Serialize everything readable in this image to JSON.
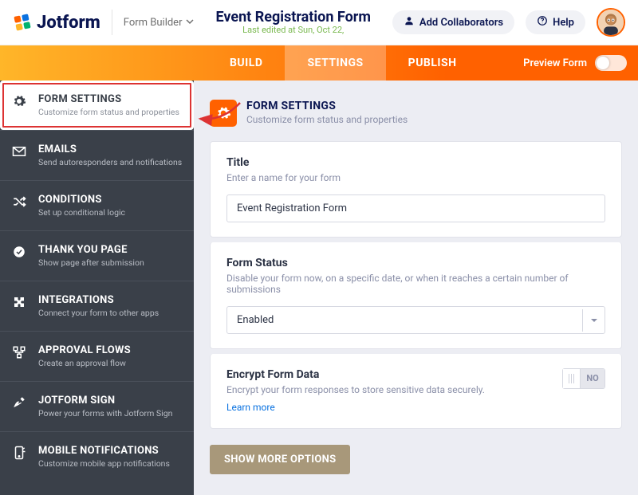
{
  "header": {
    "brand": "Jotform",
    "breadcrumb": "Form Builder",
    "formTitle": "Event Registration Form",
    "lastEdited": "Last edited at Sun, Oct 22,",
    "addCollaborators": "Add Collaborators",
    "help": "Help"
  },
  "tabs": {
    "build": "BUILD",
    "settings": "SETTINGS",
    "publish": "PUBLISH",
    "preview": "Preview Form"
  },
  "sidebar": {
    "items": [
      {
        "title": "FORM SETTINGS",
        "sub": "Customize form status and properties"
      },
      {
        "title": "EMAILS",
        "sub": "Send autoresponders and notifications"
      },
      {
        "title": "CONDITIONS",
        "sub": "Set up conditional logic"
      },
      {
        "title": "THANK YOU PAGE",
        "sub": "Show page after submission"
      },
      {
        "title": "INTEGRATIONS",
        "sub": "Connect your form to other apps"
      },
      {
        "title": "APPROVAL FLOWS",
        "sub": "Create an approval flow"
      },
      {
        "title": "JOTFORM SIGN",
        "sub": "Power your forms with Jotform Sign"
      },
      {
        "title": "MOBILE NOTIFICATIONS",
        "sub": "Customize mobile app notifications"
      }
    ]
  },
  "panel": {
    "head": {
      "title": "FORM SETTINGS",
      "sub": "Customize form status and properties"
    },
    "title": {
      "label": "Title",
      "sub": "Enter a name for your form",
      "value": "Event Registration Form"
    },
    "status": {
      "label": "Form Status",
      "sub": "Disable your form now, on a specific date, or when it reaches a certain number of submissions",
      "value": "Enabled"
    },
    "encrypt": {
      "label": "Encrypt Form Data",
      "sub": "Encrypt your form responses to store sensitive data securely.",
      "learn": "Learn more",
      "no": "NO"
    },
    "showMore": "SHOW MORE OPTIONS"
  }
}
